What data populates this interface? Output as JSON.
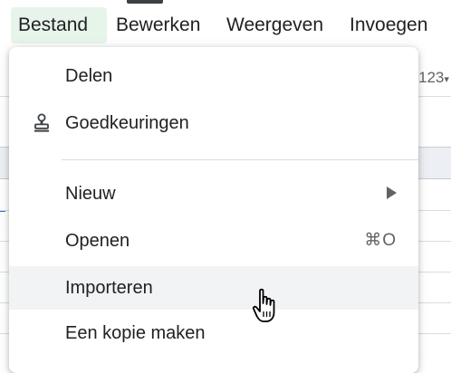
{
  "menubar": {
    "items": [
      {
        "label": "Bestand",
        "active": true
      },
      {
        "label": "Bewerken",
        "active": false
      },
      {
        "label": "Weergeven",
        "active": false
      },
      {
        "label": "Invoegen",
        "active": false
      }
    ]
  },
  "toolbar": {
    "number_format_label": "123"
  },
  "file_menu": {
    "items": [
      {
        "label": "Delen",
        "icon": null
      },
      {
        "label": "Goedkeuringen",
        "icon": "stamp-icon"
      },
      {
        "label": "Nieuw",
        "submenu": true
      },
      {
        "label": "Openen",
        "shortcut": "⌘O"
      },
      {
        "label": "Importeren",
        "hovered": true
      },
      {
        "label": "Een kopie maken"
      }
    ]
  },
  "colors": {
    "active_menu_bg": "#e6f4ea",
    "hover_bg": "#f1f3f4",
    "selection_blue": "#1a73e8"
  },
  "cursor": {
    "type": "pointer-hand-icon"
  }
}
